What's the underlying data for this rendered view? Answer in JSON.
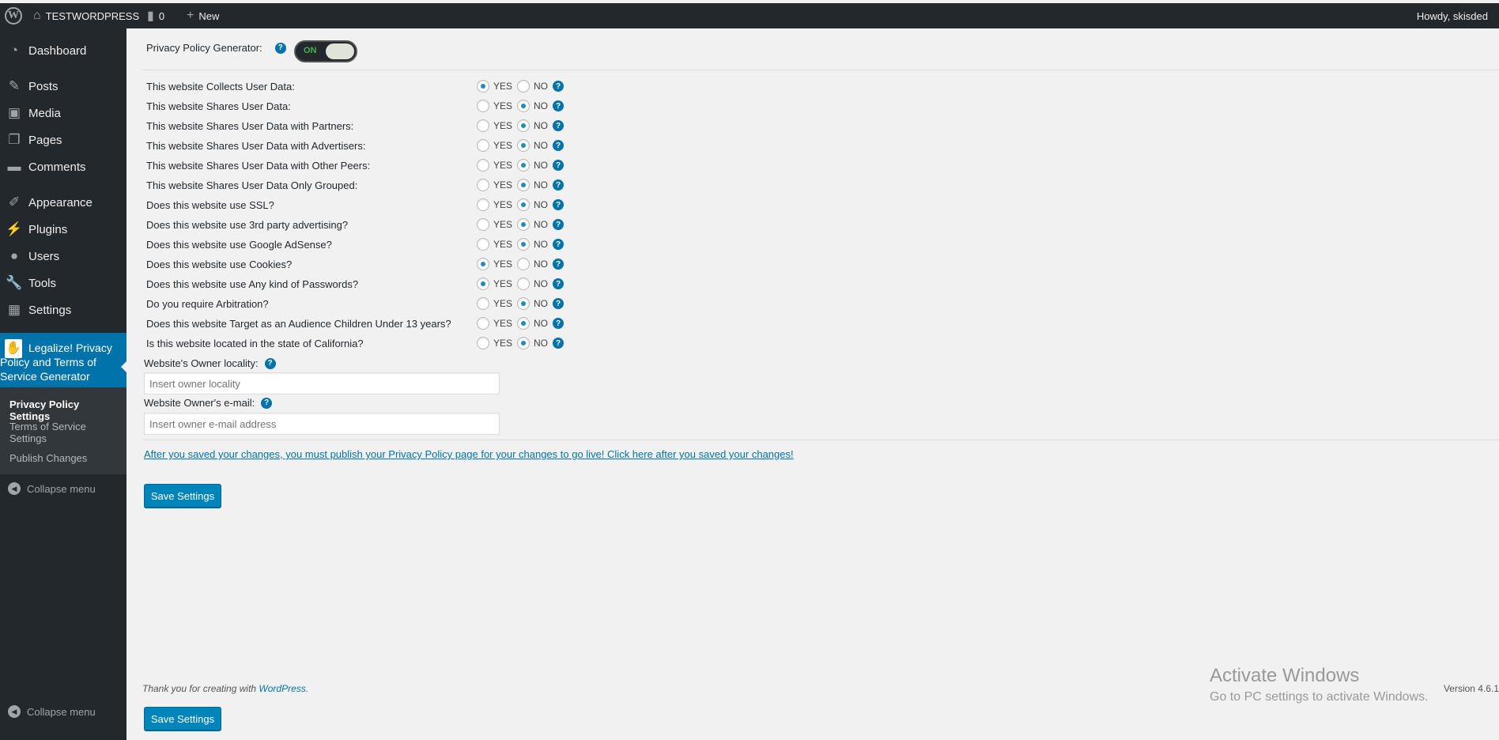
{
  "adminbar": {
    "site_name": "TESTWORDPRESS",
    "comments_count": "0",
    "new_label": "New",
    "howdy": "Howdy, skisded"
  },
  "sidebar": {
    "items": [
      {
        "label": "Dashboard",
        "icon": "dashboard-icon"
      },
      {
        "label": "Posts",
        "icon": "pin-icon"
      },
      {
        "label": "Media",
        "icon": "media-icon"
      },
      {
        "label": "Pages",
        "icon": "pages-icon"
      },
      {
        "label": "Comments",
        "icon": "comment-icon"
      },
      {
        "label": "Appearance",
        "icon": "brush-icon"
      },
      {
        "label": "Plugins",
        "icon": "plug-icon"
      },
      {
        "label": "Users",
        "icon": "user-icon"
      },
      {
        "label": "Tools",
        "icon": "wrench-icon"
      },
      {
        "label": "Settings",
        "icon": "settings-icon"
      }
    ],
    "plugin_label": "Legalize! Privacy Policy and Terms of Service Generator",
    "submenu": [
      {
        "label": "Privacy Policy Settings"
      },
      {
        "label": "Terms of Service Settings"
      },
      {
        "label": "Publish Changes"
      }
    ],
    "collapse_label": "Collapse menu"
  },
  "main": {
    "generator_label": "Privacy Policy Generator:",
    "toggle_label": "ON",
    "yes_label": "YES",
    "no_label": "NO",
    "questions": [
      {
        "label": "This website Collects User Data:",
        "value": "YES"
      },
      {
        "label": "This website Shares User Data:",
        "value": "NO"
      },
      {
        "label": "This website Shares User Data with Partners:",
        "value": "NO"
      },
      {
        "label": "This website Shares User Data with Advertisers:",
        "value": "NO"
      },
      {
        "label": "This website Shares User Data with Other Peers:",
        "value": "NO"
      },
      {
        "label": "This website Shares User Data Only Grouped:",
        "value": "NO"
      },
      {
        "label": "Does this website use SSL?",
        "value": "NO"
      },
      {
        "label": "Does this website use 3rd party advertising?",
        "value": "NO"
      },
      {
        "label": "Does this website use Google AdSense?",
        "value": "NO"
      },
      {
        "label": "Does this website use Cookies?",
        "value": "YES"
      },
      {
        "label": "Does this website use Any kind of Passwords?",
        "value": "YES"
      },
      {
        "label": "Do you require Arbitration?",
        "value": "NO"
      },
      {
        "label": "Does this website Target as an Audience Children Under 13 years?",
        "value": "NO"
      },
      {
        "label": "Is this website located in the state of California?",
        "value": "NO"
      }
    ],
    "locality_label": "Website's Owner locality:",
    "locality_placeholder": "Insert owner locality",
    "email_label": "Website Owner's e-mail:",
    "email_placeholder": "Insert owner e-mail address",
    "publish_notice": "After you saved your changes, you must publish your Privacy Policy page for your changes to go live! Click here after you saved your changes!",
    "save_label": "Save Settings"
  },
  "footer": {
    "thanks_prefix": "Thank you for creating with ",
    "wordpress_link": "WordPress",
    "thanks_suffix": ".",
    "version": "Version 4.6.1"
  },
  "watermark": {
    "line1": "Activate Windows",
    "line2": "Go to PC settings to activate Windows."
  }
}
